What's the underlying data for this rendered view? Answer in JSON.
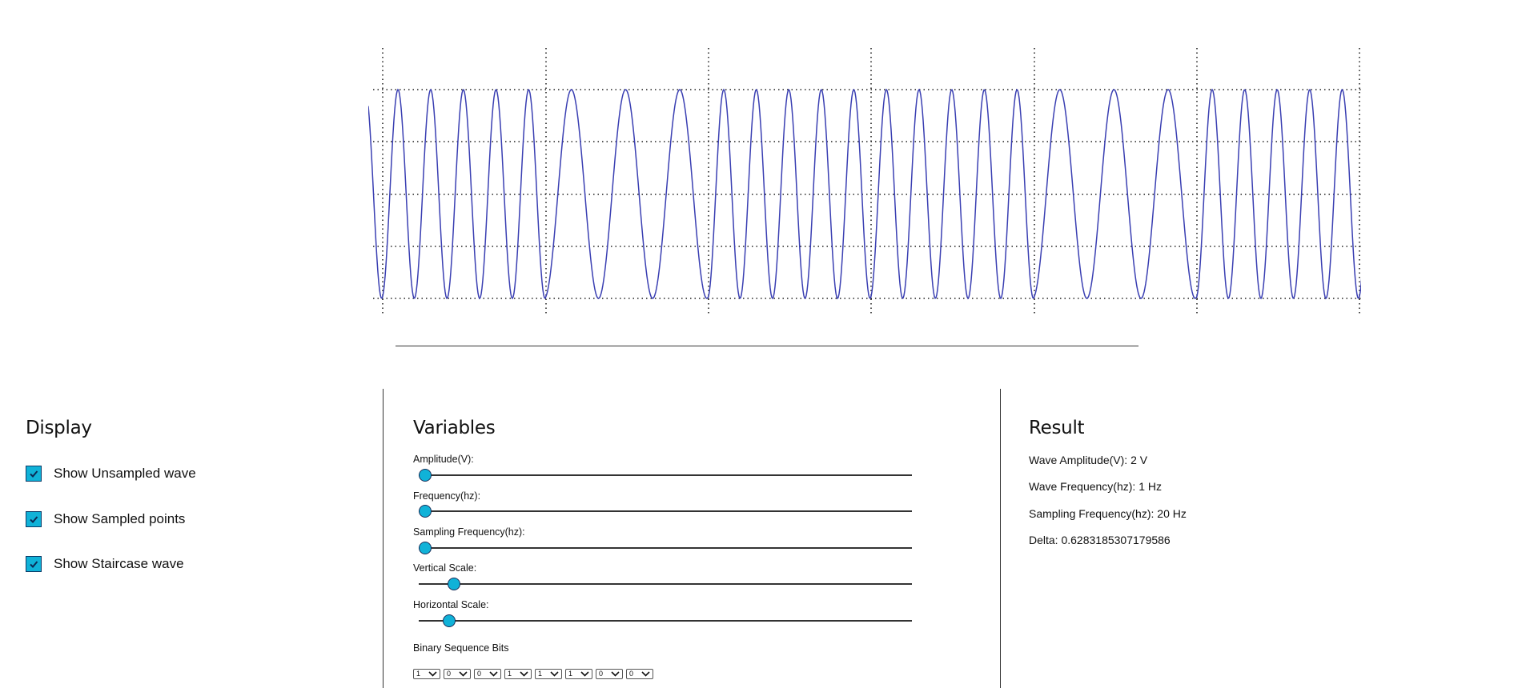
{
  "oscilloscope": {
    "wave_color": "#3a3fb2",
    "grid_color": "#222222"
  },
  "display": {
    "heading": "Display",
    "options": [
      {
        "label": "Show Unsampled wave",
        "checked": true
      },
      {
        "label": "Show Sampled points",
        "checked": true
      },
      {
        "label": "Show Staircase wave",
        "checked": true
      }
    ]
  },
  "variables": {
    "heading": "Variables",
    "sliders": [
      {
        "label": "Amplitude(V):",
        "level": 0.0
      },
      {
        "label": "Frequency(hz):",
        "level": 0.0
      },
      {
        "label": "Sampling Frequency(hz):",
        "level": 0.0
      },
      {
        "label": "Vertical Scale:",
        "level": 0.06
      },
      {
        "label": "Horizontal Scale:",
        "level": 0.05
      }
    ],
    "bits_label": "Binary Sequence Bits",
    "bits": [
      "1",
      "0",
      "0",
      "1",
      "1",
      "1",
      "0",
      "0"
    ]
  },
  "result": {
    "heading": "Result",
    "lines": [
      "Wave Amplitude(V): 2 V",
      "Wave Frequency(hz): 1 Hz",
      "Sampling Frequency(hz): 20 Hz",
      "Delta: 0.6283185307179586"
    ]
  },
  "colors": {
    "accent": "#10b2d8",
    "checkbox_border": "#0b3a66"
  }
}
